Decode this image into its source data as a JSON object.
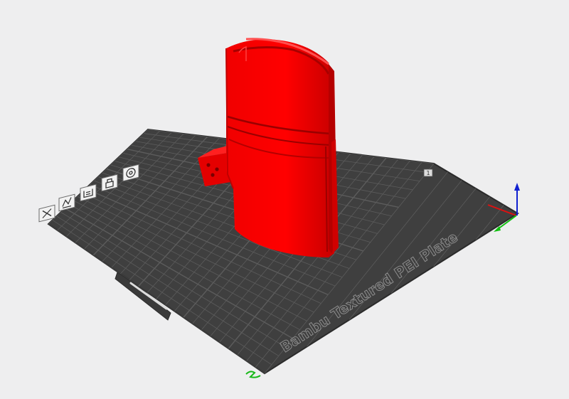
{
  "plate": {
    "name": "Bambu Textured PEI Plate",
    "plate_number": "1",
    "label_color": "#8d8d8d",
    "surface_color": "#3f3f3f",
    "grid_color": "#5c5c5c",
    "border_color": "#2b2b2b"
  },
  "model": {
    "color": "#f00000",
    "shade_color": "#c80000"
  },
  "toolbar": {
    "tools": [
      {
        "name": "delete-plate-icon"
      },
      {
        "name": "arrange-plate-icon"
      },
      {
        "name": "orient-plate-icon"
      },
      {
        "name": "lock-plate-icon"
      },
      {
        "name": "plate-settings-icon"
      }
    ]
  },
  "axes": {
    "x_color": "#e01010",
    "y_color": "#10c010",
    "z_color": "#1020d0"
  }
}
